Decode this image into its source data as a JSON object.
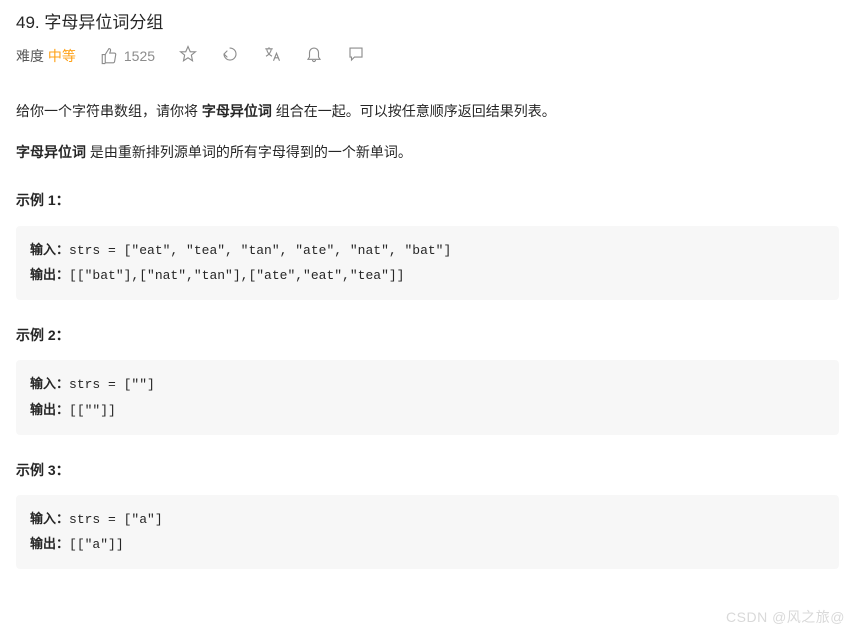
{
  "title": "49. 字母异位词分组",
  "meta": {
    "difficulty_label": "难度",
    "difficulty_value": "中等",
    "likes": "1525"
  },
  "content": {
    "p1_pre": "给你一个字符串数组，请你将 ",
    "p1_bold": "字母异位词",
    "p1_post": " 组合在一起。可以按任意顺序返回结果列表。",
    "p2_bold": "字母异位词",
    "p2_post": " 是由重新排列源单词的所有字母得到的一个新单词。"
  },
  "io": {
    "input_label": "输入：",
    "output_label": "输出："
  },
  "examples": [
    {
      "title": "示例 1：",
      "input": "strs = [\"eat\", \"tea\", \"tan\", \"ate\", \"nat\", \"bat\"]",
      "output": "[[\"bat\"],[\"nat\",\"tan\"],[\"ate\",\"eat\",\"tea\"]]"
    },
    {
      "title": "示例 2：",
      "input": "strs = [\"\"]",
      "output": "[[\"\"]]"
    },
    {
      "title": "示例 3：",
      "input": "strs = [\"a\"]",
      "output": "[[\"a\"]]"
    }
  ],
  "watermark": "CSDN @风之旅@"
}
